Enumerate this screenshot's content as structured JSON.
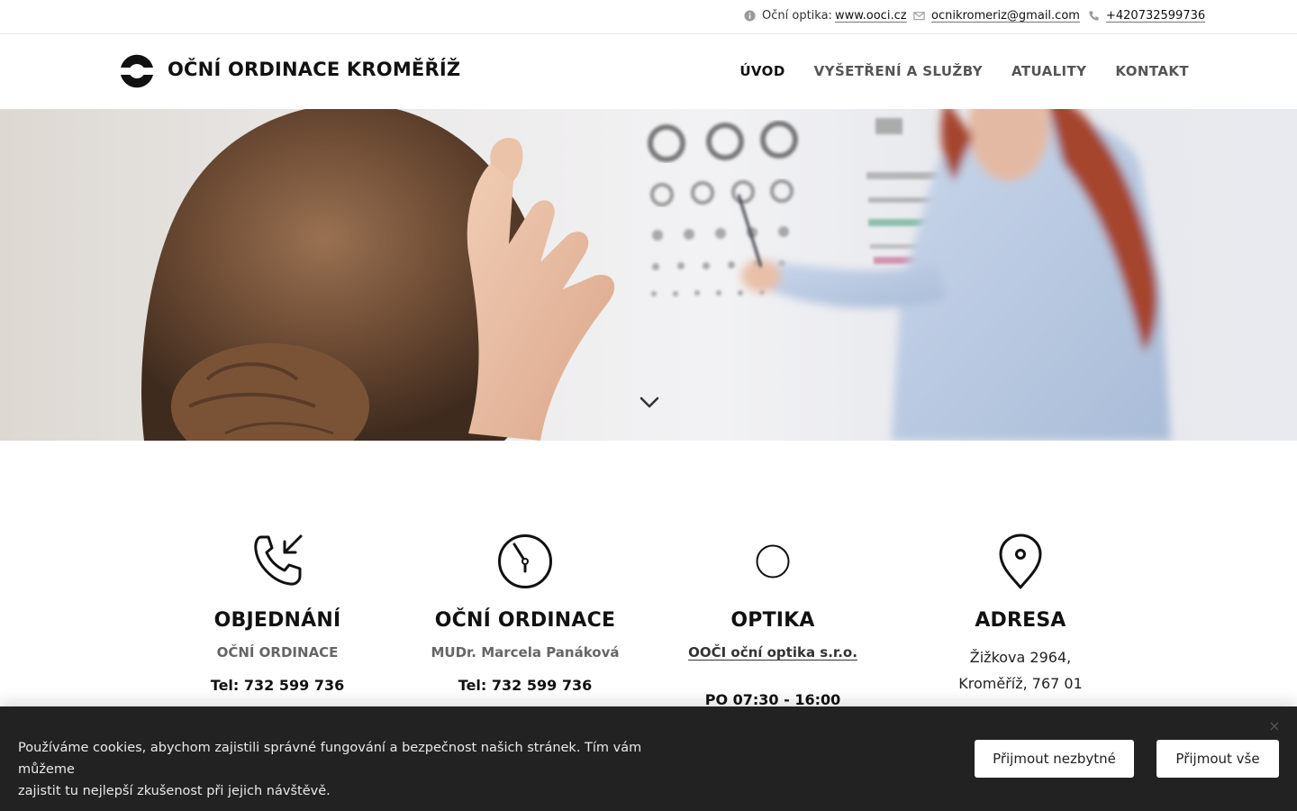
{
  "topbar": {
    "optics_label": "Oční optika:",
    "optics_link": "www.ooci.cz",
    "email": "ocnikromeriz@gmail.com",
    "phone": "+420732599736"
  },
  "header": {
    "brand": "OČNÍ ORDINACE KROMĚŘÍŽ",
    "nav": [
      {
        "label": "ÚVOD"
      },
      {
        "label": "VYŠETŘENÍ A SLUŽBY"
      },
      {
        "label": "ATUALITY"
      },
      {
        "label": "KONTAKT"
      }
    ]
  },
  "hero": {
    "scroll_icon": "chevron-down-icon"
  },
  "features": [
    {
      "icon": "phone-incoming-icon",
      "title": "OBJEDNÁNÍ",
      "subtitle": "OČNÍ ORDINACE",
      "tel": "Tel: 732 599 736"
    },
    {
      "icon": "clock-icon",
      "title": "OČNÍ ORDINACE",
      "subtitle": "MUDr. Marcela Panáková",
      "tel": "Tel: 732 599 736"
    },
    {
      "icon": "circle-icon",
      "title": "OPTIKA",
      "subtitle_link": "OOČI oční optika s.r.o.",
      "hours": "PO 07:30 - 16:00"
    },
    {
      "icon": "map-pin-icon",
      "title": "ADRESA",
      "address_line1": "Žižkova 2964,",
      "address_line2": "Kroměříž, 767 01"
    }
  ],
  "cookie": {
    "text_line1": "Používáme cookies, abychom zajistili správné fungování a bezpečnost našich stránek. Tím vám můžeme",
    "text_line2": "zajistit tu nejlepší zkušenost při jejich návštěvě.",
    "btn_necessary": "Přijmout nezbytné",
    "btn_all": "Přijmout vše",
    "close": "×"
  },
  "colors": {
    "cookie_bg": "#222222",
    "text": "#111111",
    "nav_inactive": "#555555"
  }
}
